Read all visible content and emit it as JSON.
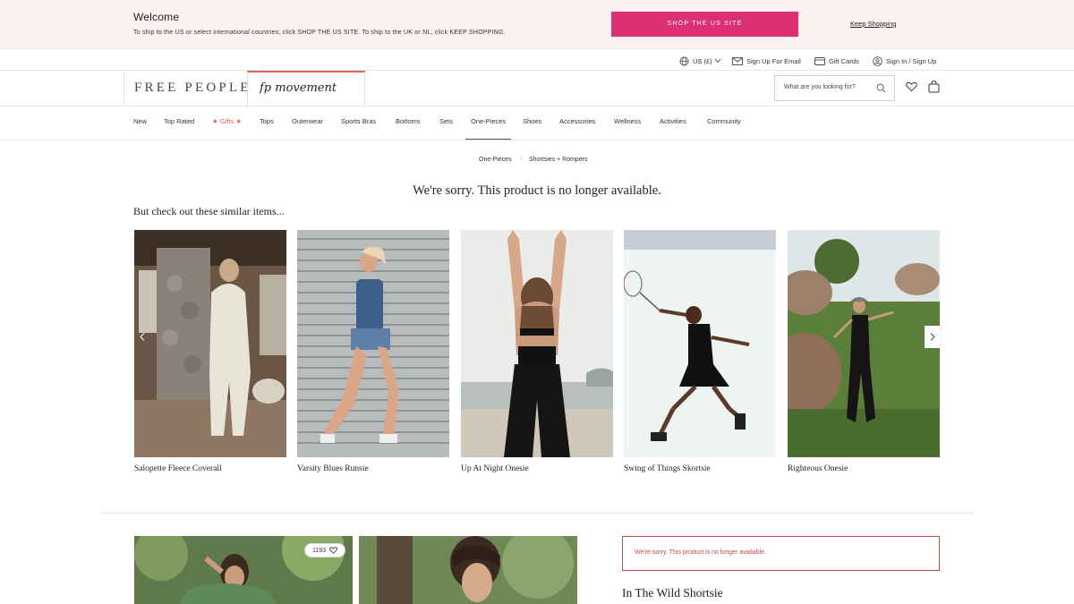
{
  "banner": {
    "title": "Welcome",
    "text": "To ship to the US or select international countries, click SHOP THE US SITE. To ship to the UK or NL, click KEEP SHOPPING.",
    "shop_us_label": "SHOP THE US SITE",
    "keep_shopping_label": "Keep Shopping",
    "button_color": "#dc2f74"
  },
  "utility": {
    "currency": "US (£)",
    "email_signup": "Sign Up For Email",
    "gift_cards": "Gift Cards",
    "sign_in": "Sign In / Sign Up"
  },
  "header": {
    "logo": "FREE PEOPLE",
    "logo_movement": "fp movement",
    "search_placeholder": "What are you looking for?"
  },
  "nav": {
    "items": [
      {
        "label": "New"
      },
      {
        "label": "Top Rated"
      },
      {
        "label": "★ Gifts ★"
      },
      {
        "label": "Tops"
      },
      {
        "label": "Outerwear"
      },
      {
        "label": "Sports Bras"
      },
      {
        "label": "Bottoms"
      },
      {
        "label": "Sets"
      },
      {
        "label": "One-Pieces"
      },
      {
        "label": "Shoes"
      },
      {
        "label": "Accessories"
      },
      {
        "label": "Wellness"
      },
      {
        "label": "Activities"
      },
      {
        "label": "Community"
      }
    ],
    "active": "One-Pieces",
    "accent_color": "#e0645c"
  },
  "breadcrumb": {
    "items": [
      "One-Pieces",
      "Shortsies + Rompers"
    ],
    "separator": "/"
  },
  "main": {
    "sorry_title": "We're sorry. This product is no longer available.",
    "similar_label": "But check out these similar items...",
    "products": [
      {
        "name": "Salopette Fleece Coverall"
      },
      {
        "name": "Varsity Blues Runsie"
      },
      {
        "name": "Up At Night Onesie"
      },
      {
        "name": "Swing of Things Skortsie"
      },
      {
        "name": "Righteous Onesie"
      }
    ]
  },
  "bottom": {
    "likes_count": "1193",
    "error_text": "We're sorry. This product is no longer available.",
    "product_title": "In The Wild Shortsie",
    "error_color": "#c14747"
  }
}
